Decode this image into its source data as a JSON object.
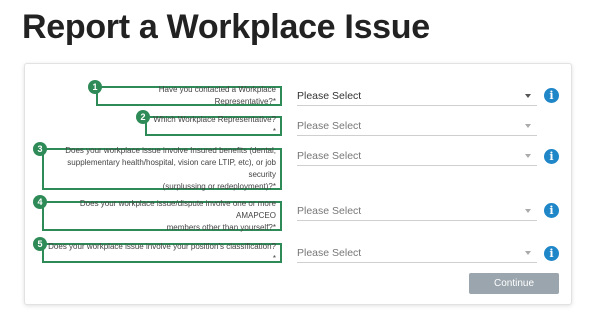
{
  "page": {
    "title": "Report a Workplace Issue"
  },
  "questions": [
    {
      "step": "1",
      "text": "Have you contacted a Workplace Representative?*",
      "select_value": "Please Select",
      "has_info": true
    },
    {
      "step": "2",
      "text": "Which Workplace Representative?*",
      "select_value": "Please Select",
      "has_info": false
    },
    {
      "step": "3",
      "lines": [
        "Does your workplace issue involve Insured benefits (dental,",
        "supplementary health/hospital, vision care LTIP, etc), or job security",
        "(surplussing or redeployment)?*"
      ],
      "select_value": "Please Select",
      "has_info": true
    },
    {
      "step": "4",
      "lines": [
        "Does your workplace issue/dispute involve one or more AMAPCEO",
        "members other than yourself?*"
      ],
      "select_value": "Please Select",
      "has_info": true
    },
    {
      "step": "5",
      "text": "Does your workplace issue involve your position's classification?*",
      "select_value": "Please Select",
      "has_info": true
    }
  ],
  "continue_label": "Continue",
  "colors": {
    "highlight_green": "#2e8b57",
    "info_blue": "#1f86c8",
    "button_gray": "#9aa5ad"
  },
  "icons": {
    "info": "info-icon",
    "dropdown": "chevron-down-icon"
  }
}
